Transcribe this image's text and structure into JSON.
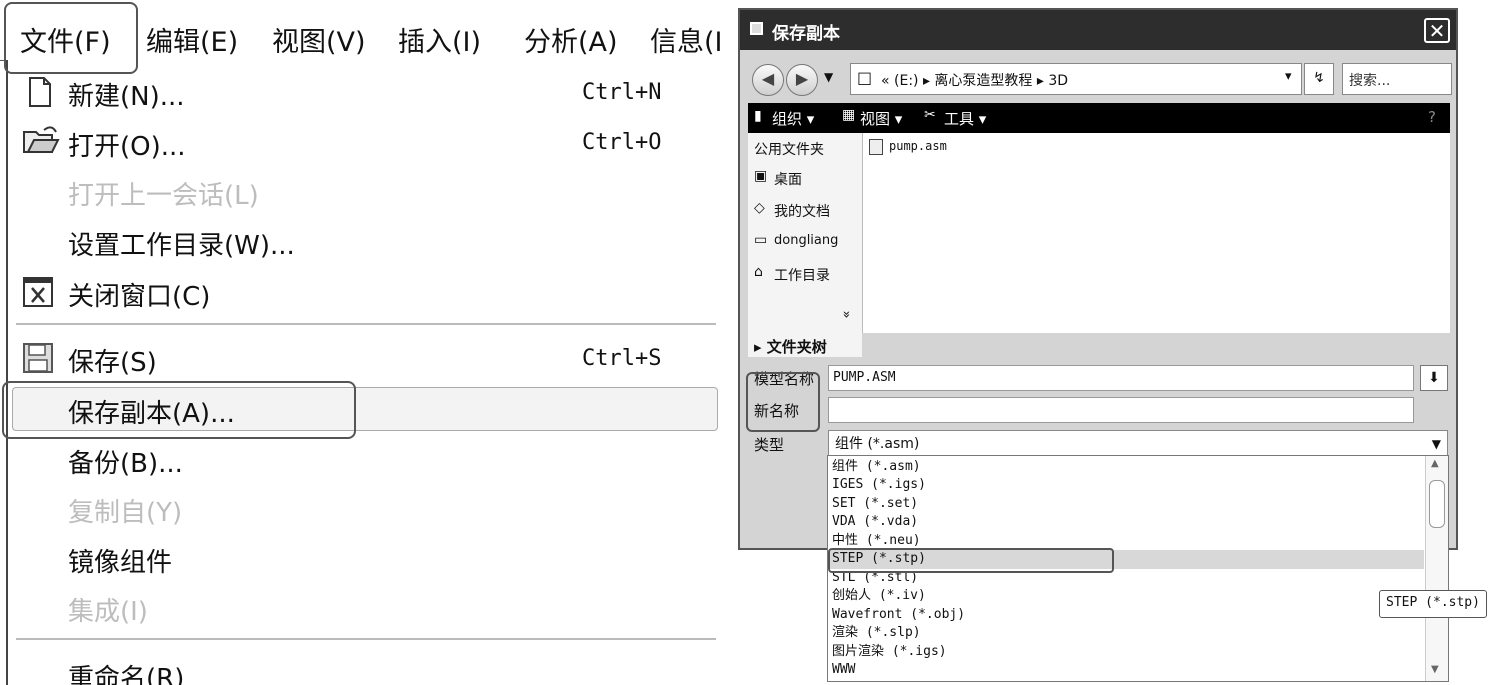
{
  "file_menu": {
    "menubar": [
      {
        "label": "文件(F)"
      },
      {
        "label": "编辑(E)"
      },
      {
        "label": "视图(V)"
      },
      {
        "label": "插入(I)"
      },
      {
        "label": "分析(A)"
      },
      {
        "label": "信息(I"
      }
    ],
    "items": {
      "new": {
        "label": "新建(N)...",
        "shortcut": "Ctrl+N"
      },
      "open": {
        "label": "打开(O)...",
        "shortcut": "Ctrl+O"
      },
      "open_last": {
        "label": "打开上一会话(L)"
      },
      "set_workdir": {
        "label": "设置工作目录(W)..."
      },
      "close": {
        "label": "关闭窗口(C)"
      },
      "save": {
        "label": "保存(S)",
        "shortcut": "Ctrl+S"
      },
      "save_copy": {
        "label": "保存副本(A)..."
      },
      "backup": {
        "label": "备份(B)..."
      },
      "copy_from": {
        "label": "复制自(Y)"
      },
      "mirror": {
        "label": "镜像组件"
      },
      "integrate": {
        "label": "集成(I)"
      },
      "rename": {
        "label": "重命名(R)"
      }
    }
  },
  "dialog": {
    "title": "保存副本",
    "close_glyph": "✕",
    "address": {
      "folder_glyph": "□",
      "text": "«  (E:) ▸ 离心泵造型教程 ▸ 3D",
      "dropdown_glyph": "▾"
    },
    "refresh_glyph": "↯",
    "search_placeholder": "搜索...",
    "toolbar": {
      "organize": "组织 ▾",
      "views": "视图 ▾",
      "tools": "工具 ▾",
      "help_glyph": "?"
    },
    "sidebar": {
      "common_folders": "公用文件夹",
      "items": [
        "桌面",
        "我的文档",
        "dongliang",
        "工作目录"
      ],
      "more_glyph": "»"
    },
    "tree_label": "▸ 文件夹树",
    "files": [
      "pump.asm"
    ],
    "fields": {
      "model_name_label": "模型名称",
      "model_name_value": "PUMP.ASM",
      "new_name_label": "新名称",
      "new_name_value": "",
      "type_label": "类型",
      "type_value": "组件 (*.asm)"
    },
    "type_options": [
      "组件 (*.asm)",
      "IGES (*.igs)",
      "SET (*.set)",
      "VDA (*.vda)",
      "中性 (*.neu)",
      "STEP (*.stp)",
      "STL (*.stl)",
      "创始人 (*.iv)",
      "Wavefront (*.obj)",
      "渲染 (*.slp)",
      "图片渲染 (*.igs)",
      "WWW"
    ],
    "selected_option": "STEP (*.stp)",
    "tooltip": "STEP (*.stp)"
  },
  "colors": {
    "titlebar": "#2d2d2d",
    "dialog_bg": "#d4d4d4",
    "highlight": "#d8d8d8",
    "callout": "#555555"
  }
}
